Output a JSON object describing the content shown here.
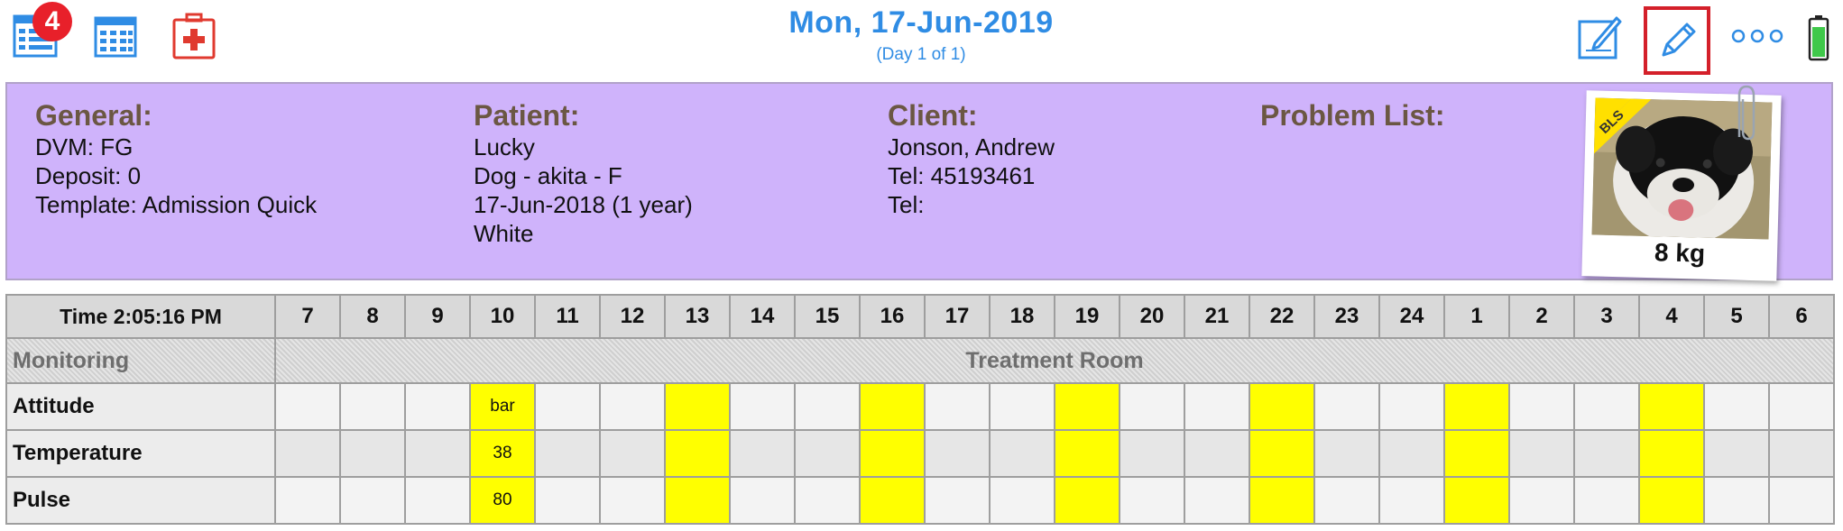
{
  "topbar": {
    "notification_count": "4",
    "date_title": "Mon, 17-Jun-2019",
    "day_subtitle": "(Day 1 of 1)",
    "icons": [
      "list-icon",
      "calendar-grid-icon",
      "medical-kit-icon",
      "compose-icon",
      "pencil-icon",
      "more-icon",
      "battery-icon"
    ],
    "accent_color": "#2f8ce4",
    "highlight_color": "#d4202a"
  },
  "info": {
    "general": {
      "heading": "General:",
      "lines": [
        "DVM: FG",
        "Deposit: 0",
        "Template: Admission Quick"
      ]
    },
    "patient": {
      "heading": "Patient:",
      "lines": [
        "Lucky",
        "Dog - akita - F",
        "17-Jun-2018 (1 year)",
        "White"
      ]
    },
    "client": {
      "heading": "Client:",
      "lines": [
        "Jonson, Andrew",
        "Tel: 45193461",
        "Tel:"
      ]
    },
    "problem_list": {
      "heading": "Problem List:"
    },
    "photo": {
      "tag": "BLS",
      "weight": "8 kg"
    },
    "panel_color": "#cfb3fb"
  },
  "grid": {
    "time_label": "Time 2:05:16 PM",
    "hours": [
      "7",
      "8",
      "9",
      "10",
      "11",
      "12",
      "13",
      "14",
      "15",
      "16",
      "17",
      "18",
      "19",
      "20",
      "21",
      "22",
      "23",
      "24",
      "1",
      "2",
      "3",
      "4",
      "5",
      "6"
    ],
    "section_label": "Monitoring",
    "room_label": "Treatment Room",
    "highlight_hours": [
      "10",
      "13",
      "16",
      "19",
      "22",
      "1",
      "4"
    ],
    "highlight_color": "#ffff00",
    "rows": [
      {
        "label": "Attitude",
        "value_at_10": "bar"
      },
      {
        "label": "Temperature",
        "value_at_10": "38"
      },
      {
        "label": "Pulse",
        "value_at_10": "80"
      }
    ]
  }
}
